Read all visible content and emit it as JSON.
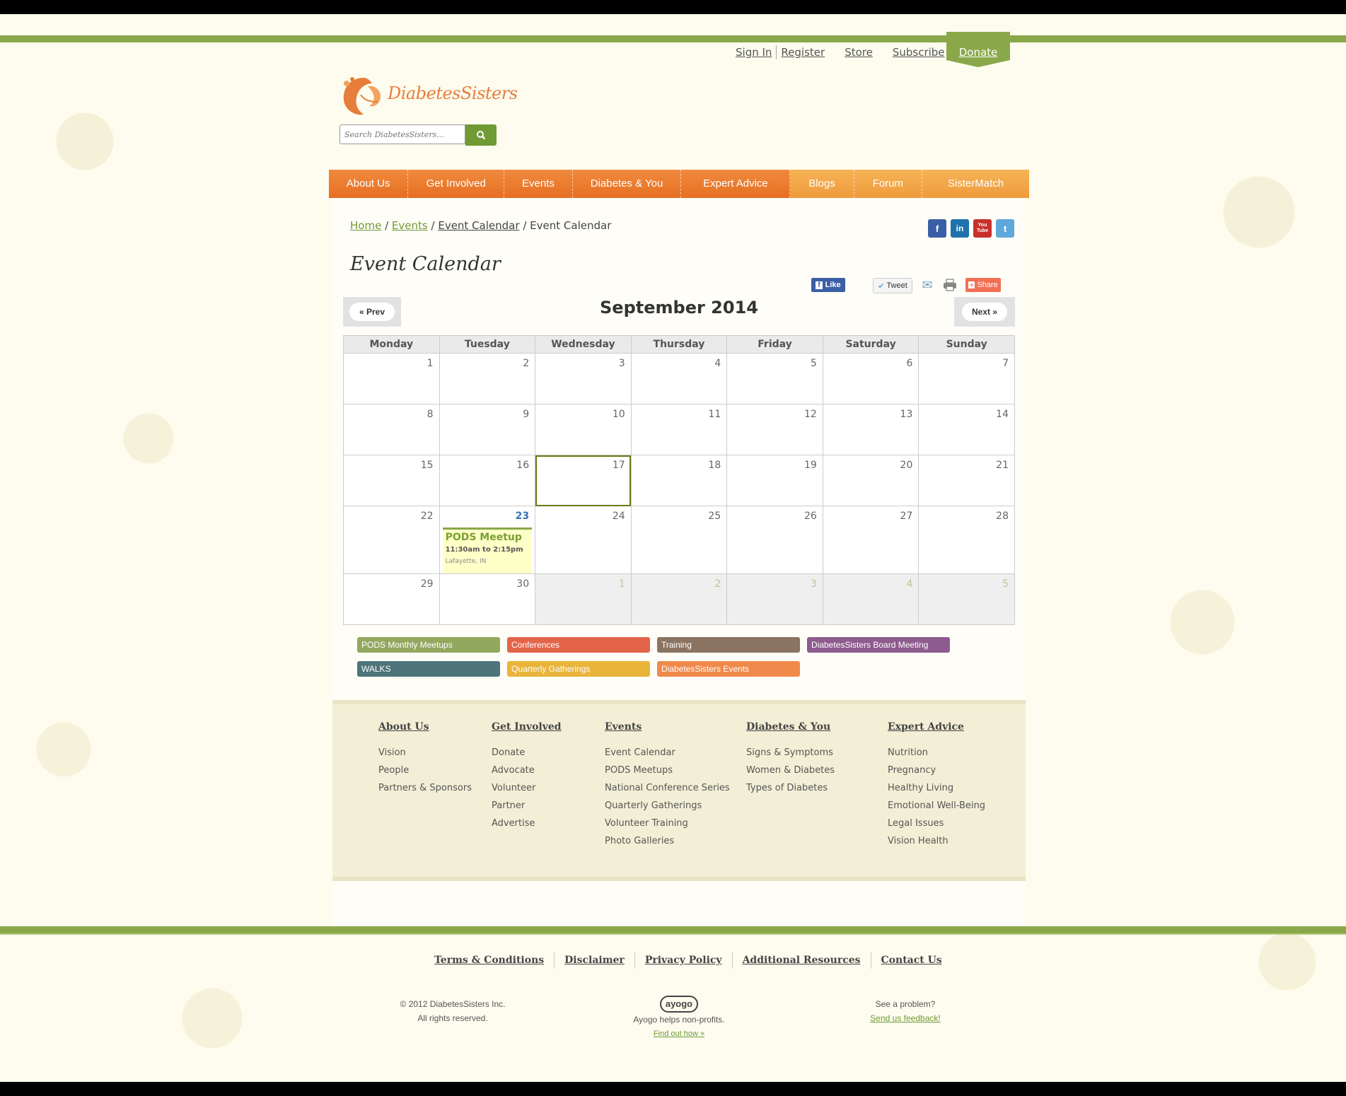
{
  "header": {
    "top_links": [
      "Sign In",
      "Register",
      "Store",
      "Subscribe"
    ],
    "donate": "Donate",
    "logo_text": "DiabetesSisters",
    "search_placeholder": "Search DiabetesSisters..."
  },
  "nav": [
    "About Us",
    "Get Involved",
    "Events",
    "Diabetes & You",
    "Expert Advice",
    "Blogs",
    "Forum",
    "SisterMatch"
  ],
  "breadcrumb": {
    "home": "Home",
    "events": "Events",
    "calendar": "Event Calendar",
    "current": "Event Calendar",
    "sep": "/"
  },
  "page": {
    "title": "Event Calendar"
  },
  "share": {
    "like": "Like",
    "tweet": "Tweet",
    "share": "Share"
  },
  "social": {
    "facebook": "f",
    "linkedin": "in",
    "youtube": "You Tube",
    "twitter": "t"
  },
  "calendar": {
    "month": "September 2014",
    "prev": "« Prev",
    "next": "Next »",
    "weekdays": [
      "Monday",
      "Tuesday",
      "Wednesday",
      "Thursday",
      "Friday",
      "Saturday",
      "Sunday"
    ],
    "weeks": [
      [
        "1",
        "2",
        "3",
        "4",
        "5",
        "6",
        "7"
      ],
      [
        "8",
        "9",
        "10",
        "11",
        "12",
        "13",
        "14"
      ],
      [
        "15",
        "16",
        "17",
        "18",
        "19",
        "20",
        "21"
      ],
      [
        "22",
        "23",
        "24",
        "25",
        "26",
        "27",
        "28"
      ],
      [
        "29",
        "30",
        "1",
        "2",
        "3",
        "4",
        "5"
      ]
    ],
    "event": {
      "title": "PODS Meetup",
      "time": "11:30am to 2:15pm",
      "location": "Lafayette, IN"
    }
  },
  "legend": [
    {
      "label": "PODS Monthly Meetups",
      "color": "#93a85f"
    },
    {
      "label": "Conferences",
      "color": "#e4644a"
    },
    {
      "label": "Training",
      "color": "#8a7461"
    },
    {
      "label": "DiabetesSisters Board Meeting",
      "color": "#8e5b8e"
    },
    {
      "label": "WALKS",
      "color": "#4d7478"
    },
    {
      "label": "Quarterly Gatherings",
      "color": "#e9b43a"
    },
    {
      "label": "DiabetesSisters Events",
      "color": "#f08a4c"
    }
  ],
  "footer": {
    "columns": [
      {
        "heading": "About Us",
        "links": [
          "Vision",
          "People",
          "Partners & Sponsors"
        ]
      },
      {
        "heading": "Get Involved",
        "links": [
          "Donate",
          "Advocate",
          "Volunteer",
          "Partner",
          "Advertise"
        ]
      },
      {
        "heading": "Events",
        "links": [
          "Event Calendar",
          "PODS Meetups",
          "National Conference Series",
          "Quarterly Gatherings",
          "Volunteer Training",
          "Photo Galleries"
        ]
      },
      {
        "heading": "Diabetes & You",
        "links": [
          "Signs & Symptoms",
          "Women & Diabetes",
          "Types of Diabetes"
        ]
      },
      {
        "heading": "Expert Advice",
        "links": [
          "Nutrition",
          "Pregnancy",
          "Healthy Living",
          "Emotional Well-Being",
          "Legal Issues",
          "Vision Health"
        ]
      }
    ],
    "legal": [
      "Terms & Conditions",
      "Disclaimer",
      "Privacy Policy",
      "Additional Resources",
      "Contact Us"
    ],
    "copyright": "© 2012 DiabetesSisters Inc.",
    "rights": "All rights reserved.",
    "ayogo_logo": "ayogo",
    "ayogo_text": "Ayogo helps non-profits.",
    "ayogo_link": "Find out how »",
    "problem": "See a problem?",
    "feedback": "Send us feedback!"
  }
}
